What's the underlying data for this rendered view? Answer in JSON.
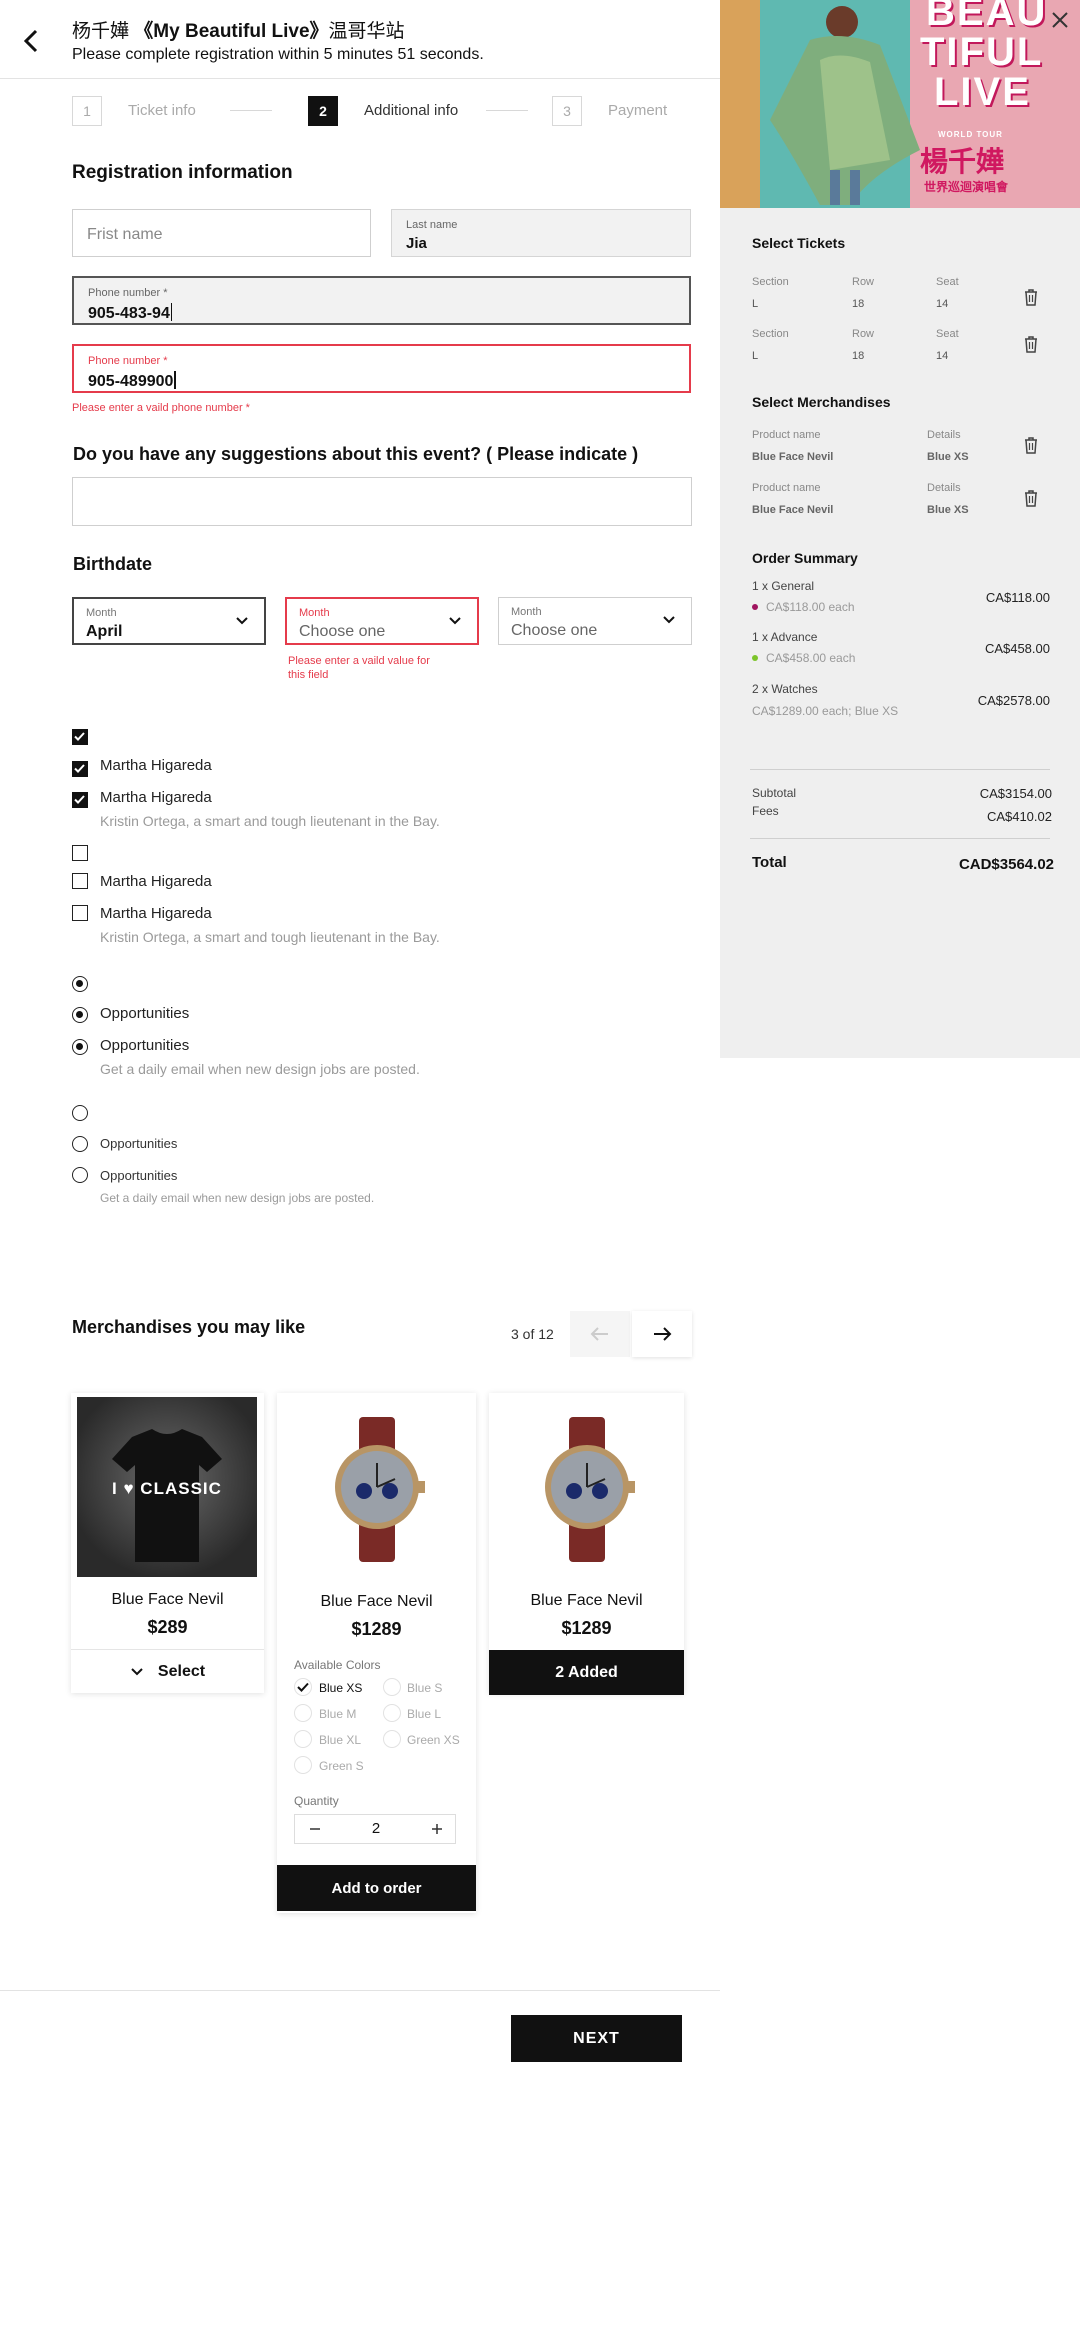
{
  "header": {
    "title_artist": "杨千嬅",
    "title_show": "《My Beautiful Live》",
    "title_city": "温哥华站",
    "subtitle": "Please complete registration within 5 minutes 51 seconds."
  },
  "steps": [
    {
      "num": "1",
      "label": "Ticket info"
    },
    {
      "num": "2",
      "label": "Additional info"
    },
    {
      "num": "3",
      "label": "Payment"
    }
  ],
  "registration": {
    "title": "Registration information",
    "first_name_placeholder": "Frist name",
    "last_name_label": "Last name",
    "last_name_value": "Jia",
    "phone1_label": "Phone number *",
    "phone1_value": "905-483-94",
    "phone2_label": "Phone number *",
    "phone2_value": "905-489900",
    "phone2_error": "Please enter a vaild phone number *"
  },
  "suggestions": {
    "question": "Do you have any suggestions about this event? ( Please indicate )"
  },
  "birthdate": {
    "title": "Birthdate",
    "month1_label": "Month",
    "month1_value": "April",
    "month2_label": "Month",
    "month2_value": "Choose one",
    "month2_error": "Please enter a vaild value for this field",
    "month3_label": "Month",
    "month3_value": "Choose one"
  },
  "checkboxes": {
    "item_label": "Martha Higareda",
    "item_desc": "Kristin Ortega, a smart and tough lieutenant in the Bay."
  },
  "radios": {
    "item_label": "Opportunities",
    "item_desc": "Get a daily email when new design jobs are posted."
  },
  "merch": {
    "title": "Merchandises you may like",
    "pager": "3 of 12",
    "cards": [
      {
        "name": "Blue Face Nevil",
        "price": "$289",
        "action": "Select",
        "image": "tshirt-classic",
        "shirt_text": "I ♥ CLASSIC"
      },
      {
        "name": "Blue Face Nevil",
        "price": "$1289",
        "image": "watch-red-strap"
      },
      {
        "name": "Blue Face Nevil",
        "price": "$1289",
        "action": "2 Added",
        "image": "watch-red-strap"
      }
    ],
    "colors_label": "Available Colors",
    "colors": [
      "Blue XS",
      "Blue S",
      "Blue M",
      "Blue L",
      "Blue XL",
      "Green XS",
      "Green S"
    ],
    "selected_color": "Blue XS",
    "quantity_label": "Quantity",
    "quantity": "2",
    "add_to_order": "Add to order"
  },
  "next_button": "NEXT",
  "poster": {
    "lines": [
      "BEAU",
      "TIFUL",
      "LIVE"
    ],
    "tour": "WORLD TOUR",
    "artist": "楊千嬅",
    "subtitle_cn": "世界巡迴演唱會"
  },
  "summary": {
    "tickets_title": "Select Tickets",
    "section_label": "Section",
    "row_label": "Row",
    "seat_label": "Seat",
    "tickets": [
      {
        "section": "L",
        "row": "18",
        "seat": "14"
      },
      {
        "section": "L",
        "row": "18",
        "seat": "14"
      }
    ],
    "merch_title": "Select Merchandises",
    "product_label": "Product name",
    "details_label": "Details",
    "merch_items": [
      {
        "name": "Blue Face Nevil",
        "details": "Blue XS"
      },
      {
        "name": "Blue Face Nevil",
        "details": "Blue XS"
      }
    ],
    "order_title": "Order Summary",
    "order_lines": [
      {
        "title": "1 x General",
        "sub": "CA$118.00 each",
        "amount": "CA$118.00",
        "dot": "#a0145f"
      },
      {
        "title": "1 x Advance",
        "sub": "CA$458.00 each",
        "amount": "CA$458.00",
        "dot": "#7cc42a"
      },
      {
        "title": "2 x Watches",
        "sub": "CA$1289.00 each; Blue XS",
        "amount": "CA$2578.00",
        "dot": ""
      }
    ],
    "subtotal_label": "Subtotal",
    "subtotal": "CA$3154.00",
    "fees_label": "Fees",
    "fees": "CA$410.02",
    "total_label": "Total",
    "total": "CAD$3564.02"
  }
}
